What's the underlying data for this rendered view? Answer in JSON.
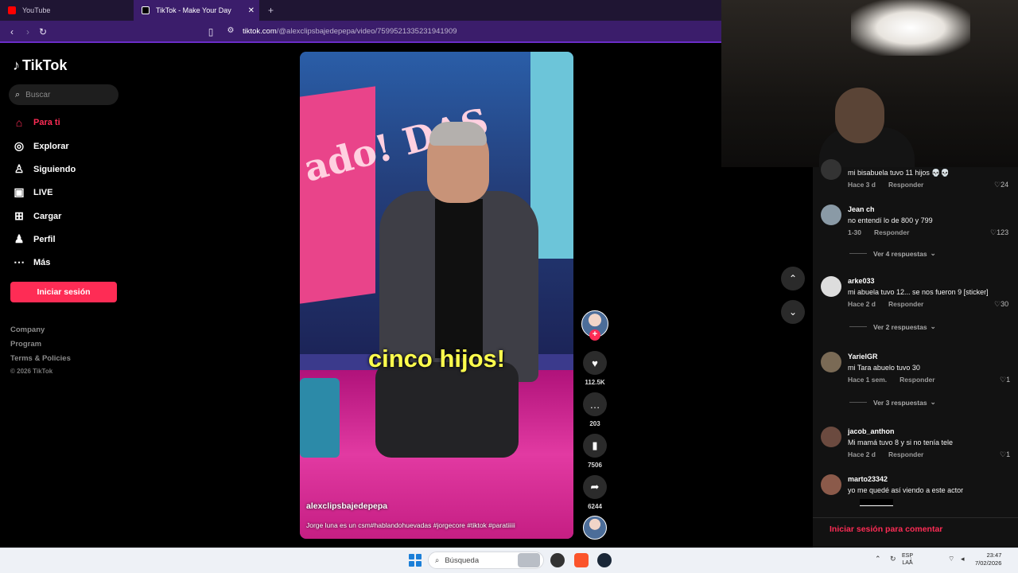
{
  "browser": {
    "tabs": [
      {
        "label": "YouTube",
        "color": "#ff0000"
      },
      {
        "label": "TikTok - Make Your Day",
        "color": "#000000"
      }
    ],
    "url_domain": "tiktok.com",
    "url_path": "/@alexclipsbajedepepa/video/7599521335231941909"
  },
  "sidebar": {
    "brand": "TikTok",
    "search_placeholder": "Buscar",
    "nav": [
      {
        "label": "Para ti",
        "icon": "home-icon"
      },
      {
        "label": "Explorar",
        "icon": "compass-icon"
      },
      {
        "label": "Siguiendo",
        "icon": "following-icon"
      },
      {
        "label": "LIVE",
        "icon": "live-icon"
      },
      {
        "label": "Cargar",
        "icon": "upload-icon"
      },
      {
        "label": "Perfil",
        "icon": "profile-icon"
      },
      {
        "label": "Más",
        "icon": "more-icon"
      }
    ],
    "login_button": "Iniciar sesión",
    "footer": [
      "Company",
      "Program",
      "Terms & Policies",
      "© 2026 TikTok"
    ]
  },
  "video": {
    "overlay_caption": "cinco hijos!",
    "author": "alexclipsbajedepepa",
    "description": "Jorge luna es un csm#hablandohuevadas #jorgecore #tiktok #paratiiiii",
    "sign_text": "ado! DAS"
  },
  "actions": {
    "likes": "112.5K",
    "comments": "203",
    "saves": "7506",
    "shares": "6244"
  },
  "comments": {
    "items": [
      {
        "user": "",
        "text": "mi bisabuela tuvo 11 hijos 💀💀",
        "time": "Hace 3 d",
        "reply": "Responder",
        "likes": "24"
      },
      {
        "user": "Jean ch",
        "text": "no entendí lo de 800 y 799",
        "time": "1-30",
        "reply": "Responder",
        "likes": "123",
        "replies": "Ver 4 respuestas"
      },
      {
        "user": "arke033",
        "text": "mi abuela tuvo 12... se nos fueron 9 [sticker]",
        "time": "Hace 2 d",
        "reply": "Responder",
        "likes": "30",
        "replies": "Ver 2 respuestas"
      },
      {
        "user": "YarielGR",
        "text": "mi Tara abuelo tuvo 30",
        "time": "Hace 1 sem.",
        "reply": "Responder",
        "likes": "1",
        "replies": "Ver 3 respuestas"
      },
      {
        "user": "jacob_anthon",
        "text": "Mi mamá tuvo 8 y si no tenía tele",
        "time": "Hace 2 d",
        "reply": "Responder",
        "likes": "1"
      },
      {
        "user": "marto23342",
        "text": "yo me quedé así viendo a este actor",
        "time": "",
        "reply": "",
        "likes": ""
      }
    ],
    "login_prompt": "Iniciar sesión para comentar"
  },
  "taskbar": {
    "search_placeholder": "Búsqueda",
    "lang_top": "ESP",
    "lang_bottom": "LAA",
    "time": "23:47",
    "date": "7/02/2026"
  },
  "colors": {
    "accent": "#fe2c55",
    "browser_bar": "#3b1d6b",
    "caption": "#ffff4d"
  }
}
